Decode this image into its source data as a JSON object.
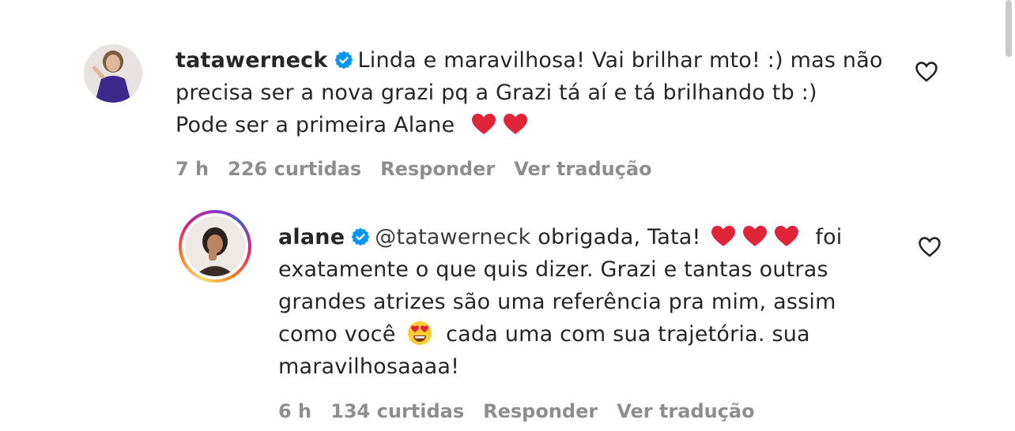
{
  "comments": [
    {
      "username": "tatawerneck",
      "verified_icon": "verified-badge-icon",
      "line1": "Linda e maravilhosa! Vai brilhar mto! :) mas não",
      "line2": "precisa ser a nova grazi pq a Grazi tá aí e tá brilhando tb :)",
      "line3_text": "Pode ser a primeira Alane",
      "time": "7 h",
      "likes": "226 curtidas",
      "reply": "Responder",
      "translate": "Ver tradução"
    },
    {
      "username": "alane",
      "verified_icon": "verified-badge-icon",
      "mention": "@tatawerneck",
      "line1_text": "obrigada, Tata!",
      "line1_after": "foi",
      "line2": "exatamente o que quis dizer. Grazi e tantas outras",
      "line3": "grandes atrizes são uma referência pra mim, assim",
      "line4_before": "como você",
      "line4_after": "cada uma com sua trajetória. sua",
      "line5": "maravilhosaaaa!",
      "time": "6 h",
      "likes": "134 curtidas",
      "reply": "Responder",
      "translate": "Ver tradução"
    }
  ],
  "colors": {
    "heart_red": "#e0243a",
    "verified_blue": "#0095f6",
    "meta_gray": "#8e8e8e"
  }
}
